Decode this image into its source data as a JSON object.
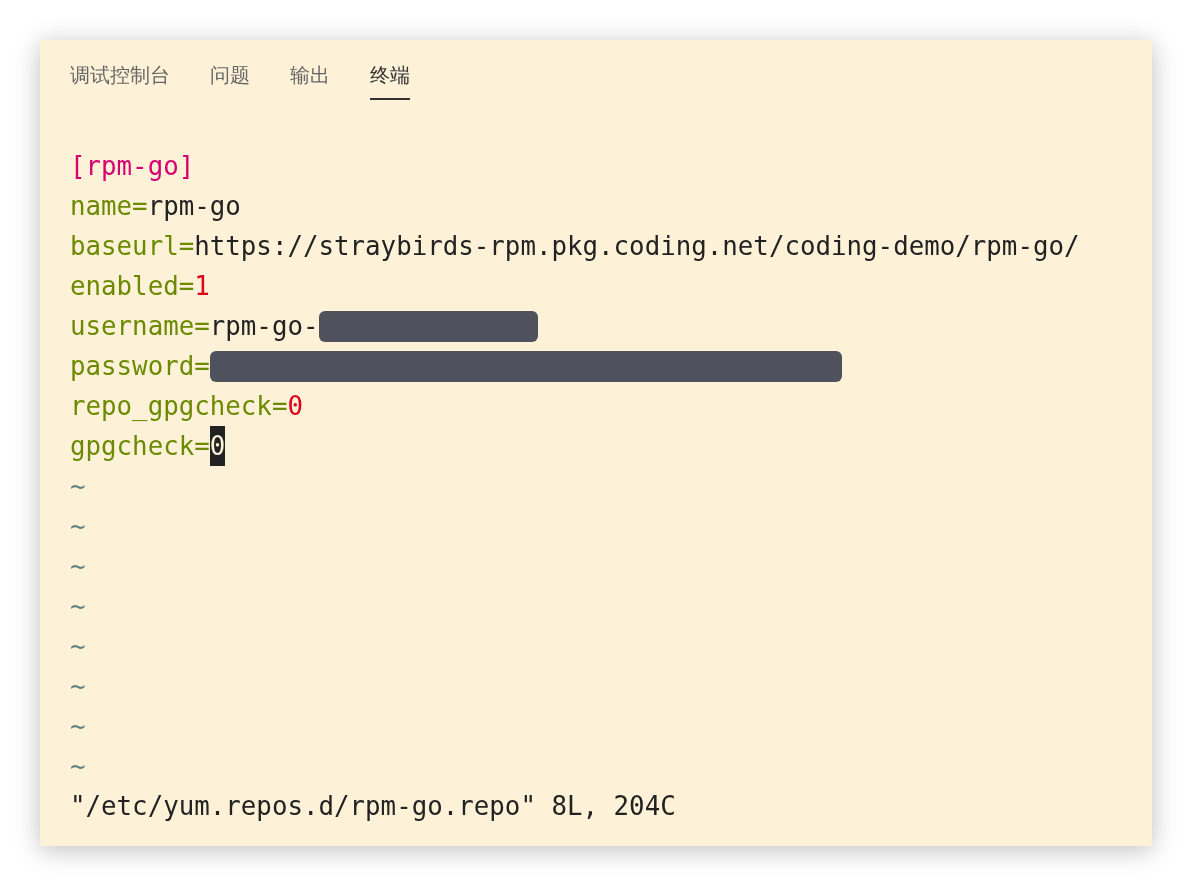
{
  "tabs": [
    {
      "label": "调试控制台",
      "selected": false
    },
    {
      "label": "问题",
      "selected": false
    },
    {
      "label": "输出",
      "selected": false
    },
    {
      "label": "终端",
      "selected": true
    }
  ],
  "terminal": {
    "lines": [
      [
        {
          "kind": "section",
          "text": "[rpm-go]"
        }
      ],
      [
        {
          "kind": "key",
          "text": "name="
        },
        {
          "kind": "value",
          "text": "rpm-go"
        }
      ],
      [
        {
          "kind": "key",
          "text": "baseurl="
        },
        {
          "kind": "value",
          "text": "https://straybirds-rpm.pkg.coding.net/coding-demo/rpm-go/"
        }
      ],
      [
        {
          "kind": "key",
          "text": "enabled="
        },
        {
          "kind": "number",
          "text": "1"
        }
      ],
      [
        {
          "kind": "key",
          "text": "username="
        },
        {
          "kind": "value",
          "text": "rpm-go-"
        },
        {
          "kind": "redacted_short"
        }
      ],
      [
        {
          "kind": "key",
          "text": "password="
        },
        {
          "kind": "redacted_long"
        }
      ],
      [
        {
          "kind": "key",
          "text": "repo_gpgcheck="
        },
        {
          "kind": "number",
          "text": "0"
        }
      ],
      [
        {
          "kind": "key",
          "text": "gpgcheck="
        },
        {
          "kind": "cursor",
          "text": "0"
        }
      ],
      [
        {
          "kind": "tilde",
          "text": "~"
        }
      ],
      [
        {
          "kind": "tilde",
          "text": "~"
        }
      ],
      [
        {
          "kind": "tilde",
          "text": "~"
        }
      ],
      [
        {
          "kind": "tilde",
          "text": "~"
        }
      ],
      [
        {
          "kind": "tilde",
          "text": "~"
        }
      ],
      [
        {
          "kind": "tilde",
          "text": "~"
        }
      ],
      [
        {
          "kind": "tilde",
          "text": "~"
        }
      ],
      [
        {
          "kind": "tilde",
          "text": "~"
        }
      ],
      [
        {
          "kind": "value",
          "text": "\"/etc/yum.repos.d/rpm-go.repo\" 8L, 204C"
        }
      ]
    ]
  }
}
